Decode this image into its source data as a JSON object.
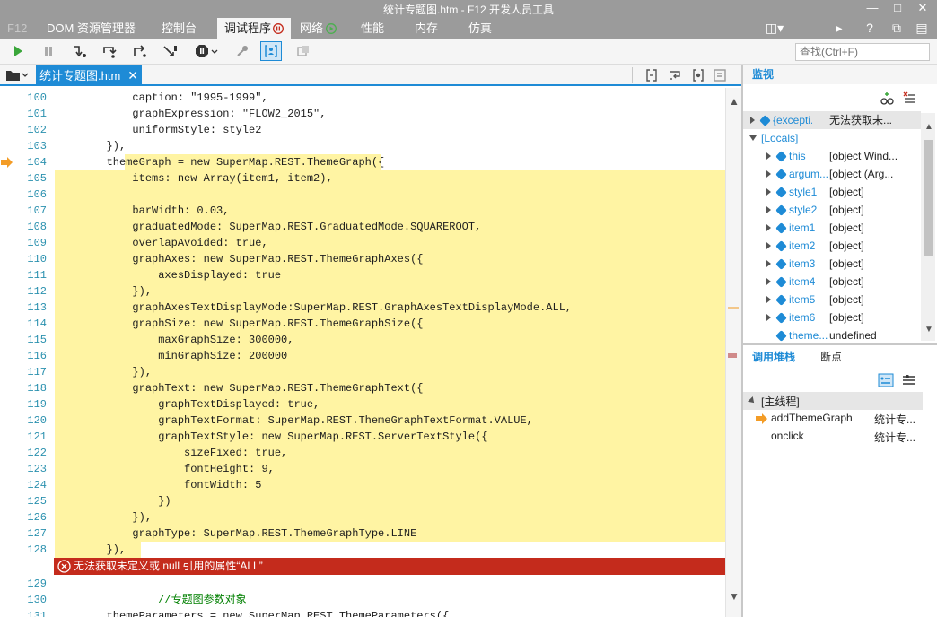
{
  "window": {
    "title": "统计专题图.htm - F12 开发人员工具",
    "f12_label": "F12"
  },
  "main_tabs": [
    {
      "label": "DOM 资源管理器"
    },
    {
      "label": "控制台"
    },
    {
      "label": "调试程序"
    },
    {
      "label": "网络"
    },
    {
      "label": "性能"
    },
    {
      "label": "内存"
    },
    {
      "label": "仿真"
    }
  ],
  "search": {
    "placeholder": "查找(Ctrl+F)"
  },
  "file_tab": {
    "name": "统计专题图.htm"
  },
  "code": {
    "lines": [
      {
        "n": "100",
        "t": "            caption: \"1995-1999\","
      },
      {
        "n": "101",
        "t": "            graphExpression: \"FLOW2_2015\","
      },
      {
        "n": "102",
        "t": "            uniformStyle: style2"
      },
      {
        "n": "103",
        "t": "        }),"
      },
      {
        "n": "104",
        "t": "        themeGraph = new SuperMap.REST.ThemeGraph({"
      },
      {
        "n": "105",
        "t": "            items: new Array(item1, item2),"
      },
      {
        "n": "106",
        "t": ""
      },
      {
        "n": "107",
        "t": "            barWidth: 0.03,"
      },
      {
        "n": "108",
        "t": "            graduatedMode: SuperMap.REST.GraduatedMode.SQUAREROOT,"
      },
      {
        "n": "109",
        "t": "            overlapAvoided: true,"
      },
      {
        "n": "110",
        "t": "            graphAxes: new SuperMap.REST.ThemeGraphAxes({"
      },
      {
        "n": "111",
        "t": "                axesDisplayed: true"
      },
      {
        "n": "112",
        "t": "            }),"
      },
      {
        "n": "113",
        "t": "            graphAxesTextDisplayMode:SuperMap.REST.GraphAxesTextDisplayMode.ALL,"
      },
      {
        "n": "114",
        "t": "            graphSize: new SuperMap.REST.ThemeGraphSize({"
      },
      {
        "n": "115",
        "t": "                maxGraphSize: 300000,"
      },
      {
        "n": "116",
        "t": "                minGraphSize: 200000"
      },
      {
        "n": "117",
        "t": "            }),"
      },
      {
        "n": "118",
        "t": "            graphText: new SuperMap.REST.ThemeGraphText({"
      },
      {
        "n": "119",
        "t": "                graphTextDisplayed: true,"
      },
      {
        "n": "120",
        "t": "                graphTextFormat: SuperMap.REST.ThemeGraphTextFormat.VALUE,"
      },
      {
        "n": "121",
        "t": "                graphTextStyle: new SuperMap.REST.ServerTextStyle({"
      },
      {
        "n": "122",
        "t": "                    sizeFixed: true,"
      },
      {
        "n": "123",
        "t": "                    fontHeight: 9,"
      },
      {
        "n": "124",
        "t": "                    fontWidth: 5"
      },
      {
        "n": "125",
        "t": "                })"
      },
      {
        "n": "126",
        "t": "            }),"
      },
      {
        "n": "127",
        "t": "            graphType: SuperMap.REST.ThemeGraphType.LINE"
      },
      {
        "n": "128",
        "t": "        }),"
      },
      {
        "n": "129",
        "t": ""
      },
      {
        "n": "130",
        "t": "                //专题图参数对象"
      },
      {
        "n": "131",
        "t": "        themeParameters = new SuperMap.REST.ThemeParameters({"
      }
    ],
    "error_message": "无法获取未定义或 null 引用的属性“ALL”"
  },
  "watch": {
    "header": "监视",
    "rows": [
      {
        "name": "{excepti...",
        "value": "无法获取未..."
      },
      {
        "name": "[Locals]",
        "value": ""
      },
      {
        "name": "this",
        "value": "[object Wind..."
      },
      {
        "name": "argum...",
        "value": "[object (Arg..."
      },
      {
        "name": "style1",
        "value": "[object]"
      },
      {
        "name": "style2",
        "value": "[object]"
      },
      {
        "name": "item1",
        "value": "[object]"
      },
      {
        "name": "item2",
        "value": "[object]"
      },
      {
        "name": "item3",
        "value": "[object]"
      },
      {
        "name": "item4",
        "value": "[object]"
      },
      {
        "name": "item5",
        "value": "[object]"
      },
      {
        "name": "item6",
        "value": "[object]"
      },
      {
        "name": "theme...",
        "value": "undefined"
      }
    ]
  },
  "callstack": {
    "tab_label": "调用堆栈",
    "tab2_label": "断点",
    "thread": "[主线程]",
    "frames": [
      {
        "fn": "addThemeGraph",
        "loc": "统计专..."
      },
      {
        "fn": "onclick",
        "loc": "统计专..."
      }
    ]
  },
  "colors": {
    "accent": "#1e8bd6",
    "highlight": "#fff4a3",
    "error": "#c42b1c"
  }
}
